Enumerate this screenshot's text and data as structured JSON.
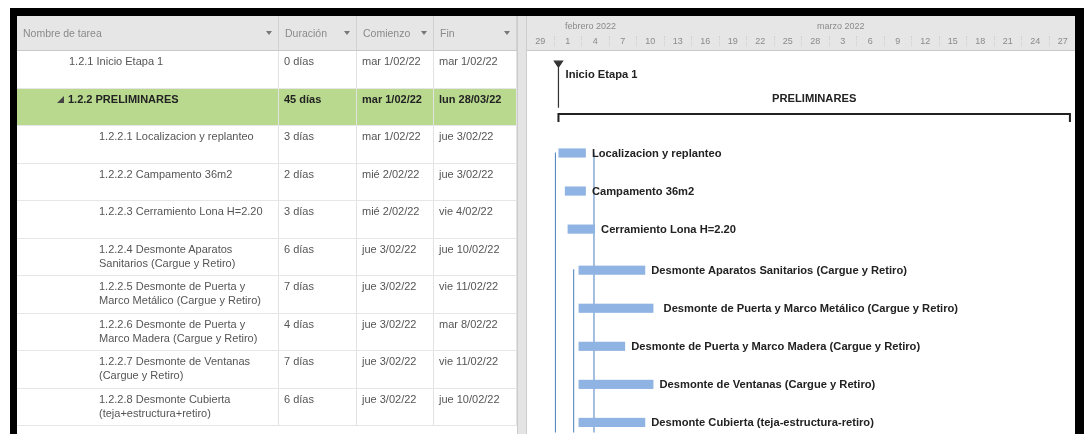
{
  "table": {
    "columns": [
      {
        "label": "Nombre de tarea",
        "kind": "name"
      },
      {
        "label": "Duración",
        "kind": "duration"
      },
      {
        "label": "Comienzo",
        "kind": "start"
      },
      {
        "label": "Fin",
        "kind": "finish"
      }
    ],
    "rows": [
      {
        "name": "1.2.1 Inicio Etapa 1",
        "duration": "0 días",
        "start": "mar 1/02/22",
        "finish": "mar 1/02/22",
        "kind": "milestone",
        "selected": false
      },
      {
        "name": "1.2.2 PRELIMINARES",
        "duration": "45 días",
        "start": "mar 1/02/22",
        "finish": "lun 28/03/22",
        "kind": "summary",
        "selected": true,
        "expanded": true,
        "children": [
          {
            "name": "1.2.2.1 Localizacion y replanteo",
            "duration": "3 días",
            "start": "mar 1/02/22",
            "finish": "jue 3/02/22",
            "kind": "task",
            "selected": false
          },
          {
            "name": "1.2.2.2 Campamento 36m2",
            "duration": "2 días",
            "start": "mié 2/02/22",
            "finish": "jue 3/02/22",
            "kind": "task",
            "selected": false
          },
          {
            "name": "1.2.2.3 Cerramiento Lona H=2.20",
            "duration": "3 días",
            "start": "mié 2/02/22",
            "finish": "vie 4/02/22",
            "kind": "task",
            "selected": false
          },
          {
            "name": "1.2.2.4 Desmonte Aparatos Sanitarios (Cargue y Retiro)",
            "duration": "6 días",
            "start": "jue 3/02/22",
            "finish": "jue 10/02/22",
            "kind": "task",
            "selected": false
          },
          {
            "name": "1.2.2.5 Desmonte de Puerta y Marco Metálico (Cargue y Retiro)",
            "duration": "7 días",
            "start": "jue 3/02/22",
            "finish": "vie 11/02/22",
            "kind": "task",
            "selected": false
          },
          {
            "name": "1.2.2.6 Desmonte de Puerta y Marco Madera (Cargue y Retiro)",
            "duration": "4 días",
            "start": "jue 3/02/22",
            "finish": "mar 8/02/22",
            "kind": "task",
            "selected": false
          },
          {
            "name": "1.2.2.7 Desmonte de Ventanas (Cargue y Retiro)",
            "duration": "7 días",
            "start": "jue 3/02/22",
            "finish": "vie 11/02/22",
            "kind": "task",
            "selected": false
          },
          {
            "name": "1.2.2.8 Desmonte Cubierta (teja+estructura+retiro)",
            "duration": "6 días",
            "start": "jue 3/02/22",
            "finish": "jue 10/02/22",
            "kind": "task",
            "selected": false
          }
        ]
      }
    ]
  },
  "gantt": {
    "months": [
      "febrero 2022",
      "marzo 2022"
    ],
    "days": [
      "29",
      "1",
      "4",
      "7",
      "10",
      "13",
      "16",
      "19",
      "22",
      "25",
      "28",
      "3",
      "6",
      "9",
      "12",
      "15",
      "18",
      "21",
      "24",
      "27"
    ],
    "items": [
      {
        "label": "Inicio Etapa 1",
        "kind": "milestone"
      },
      {
        "label": "PRELIMINARES",
        "kind": "summary"
      },
      {
        "label": "Localizacion y replanteo",
        "kind": "task"
      },
      {
        "label": "Campamento 36m2",
        "kind": "task"
      },
      {
        "label": "Cerramiento Lona H=2.20",
        "kind": "task"
      },
      {
        "label": "Desmonte Aparatos Sanitarios (Cargue y Retiro)",
        "kind": "task"
      },
      {
        "label": "Desmonte de Puerta y Marco Metálico (Cargue y Retiro)",
        "kind": "task"
      },
      {
        "label": "Desmonte de Puerta y Marco Madera (Cargue y Retiro)",
        "kind": "task"
      },
      {
        "label": "Desmonte de Ventanas (Cargue y Retiro)",
        "kind": "task"
      },
      {
        "label": "Desmonte Cubierta (teja-estructura-retiro)",
        "kind": "task"
      }
    ]
  }
}
